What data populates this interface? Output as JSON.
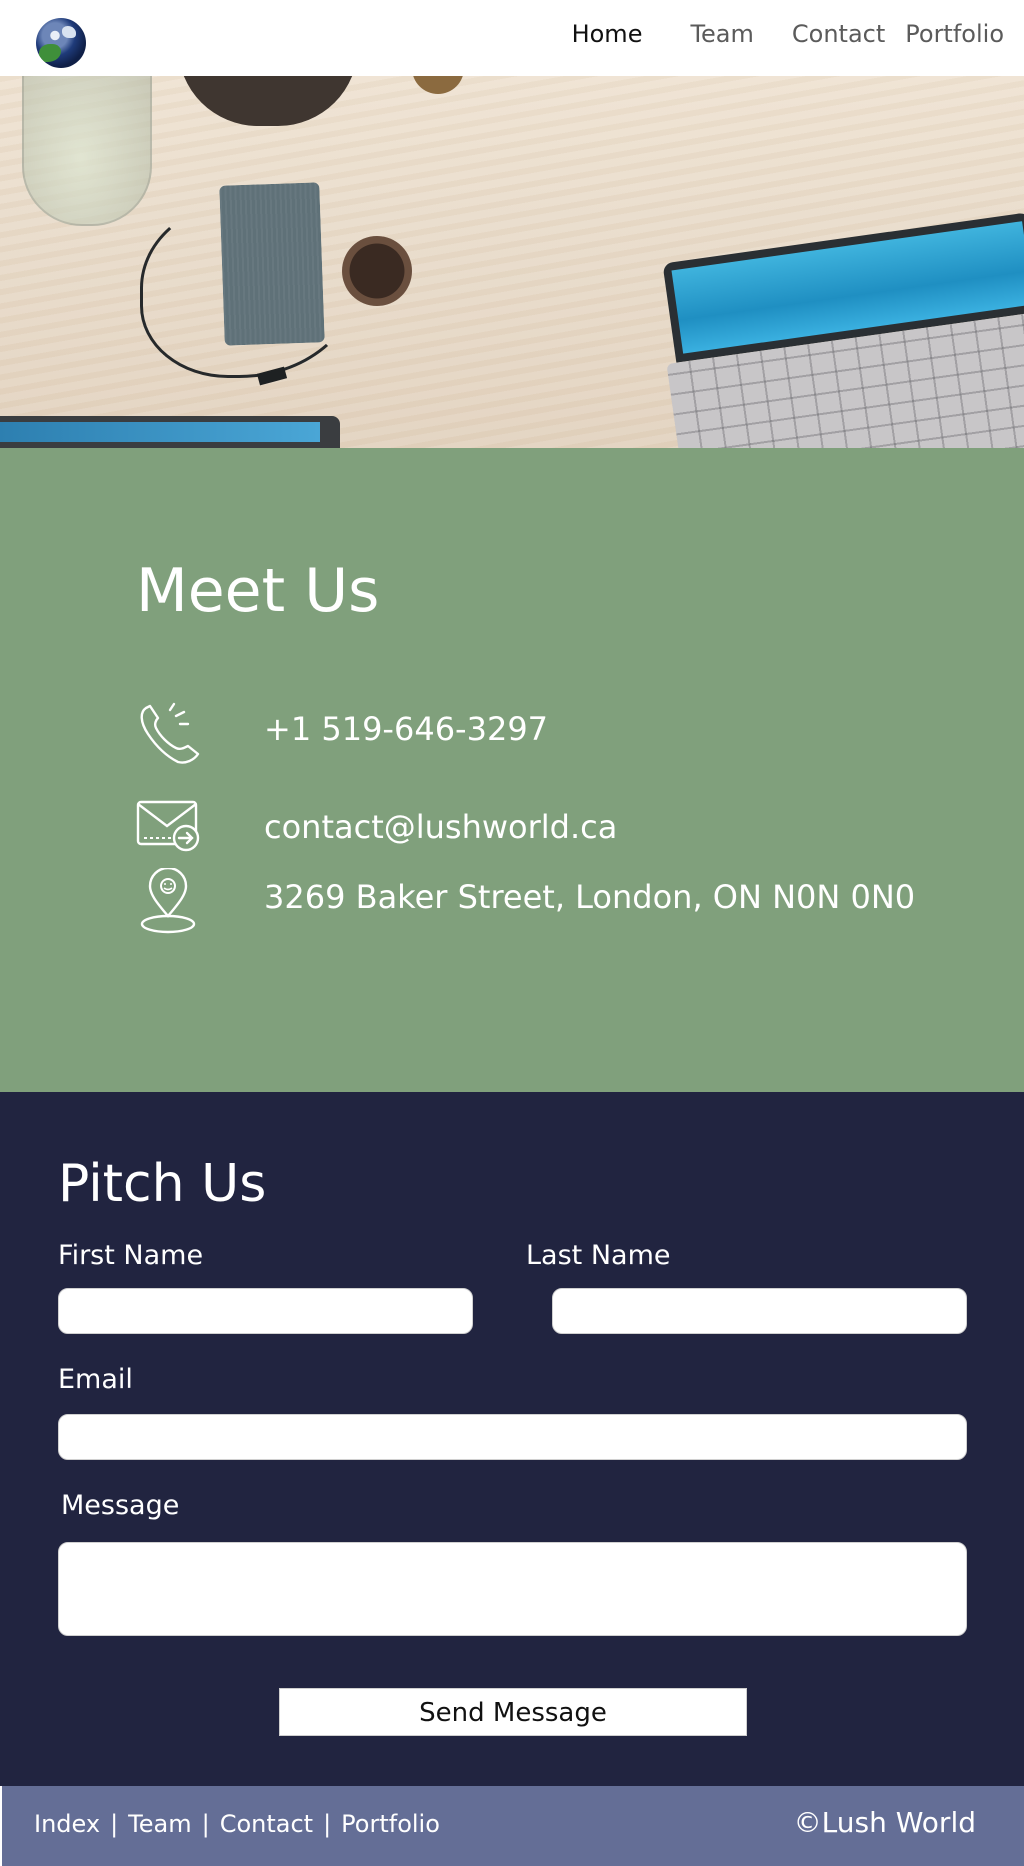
{
  "nav": {
    "links": [
      "Home",
      "Team",
      "Contact",
      "Portfolio"
    ],
    "active": "Home"
  },
  "meet": {
    "title": "Meet Us",
    "phone": "+1 519-646-3297",
    "email": "contact@lushworld.ca",
    "address": "3269 Baker Street, London, ON N0N 0N0",
    "icons": [
      "phone-icon",
      "mail-icon",
      "location-pin-icon"
    ]
  },
  "pitch": {
    "title": "Pitch Us",
    "first_name_label": "First Name",
    "last_name_label": "Last Name",
    "email_label": "Email",
    "message_label": "Message",
    "first_name_value": "",
    "last_name_value": "",
    "email_value": "",
    "message_value": "",
    "send_label": "Send Message"
  },
  "footer": {
    "links": [
      "Index",
      "Team",
      "Contact",
      "Portfolio"
    ],
    "separator": "|",
    "copyright": "©Lush World"
  },
  "colors": {
    "meet_bg": "#80a07c",
    "pitch_bg": "#212440",
    "footer_bg": "#646e96"
  }
}
